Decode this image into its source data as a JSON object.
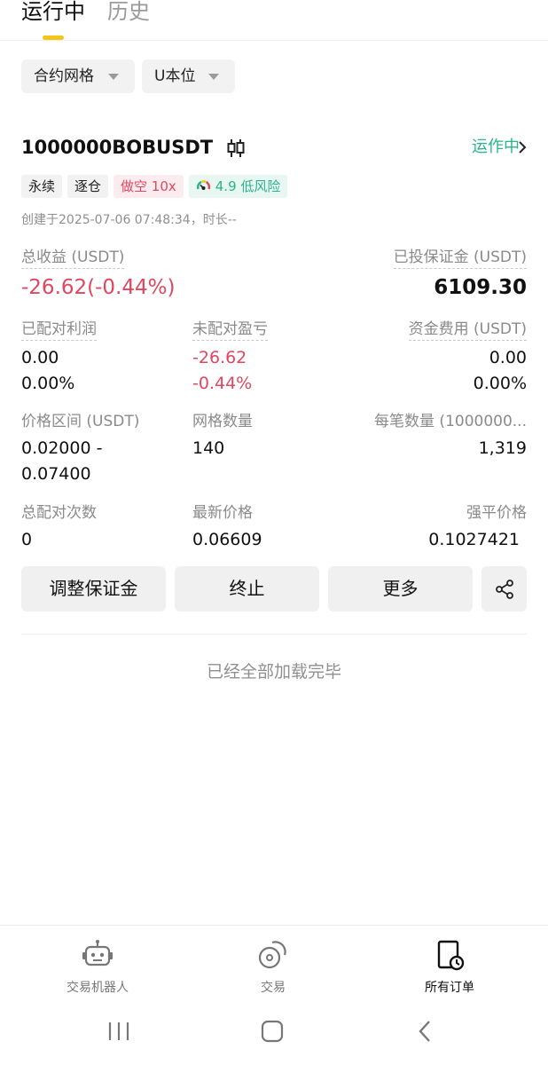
{
  "tabs": {
    "active": "运行中",
    "inactive": "历史"
  },
  "filters": {
    "type": "合约网格",
    "unit": "U本位"
  },
  "card": {
    "symbol": "1000000BOBUSDT",
    "symbol_icon": "candlestick-icon",
    "status": "运作中",
    "tags": {
      "perpetual": "永续",
      "isolated": "逐仓",
      "short": "做空 10x",
      "risk": "4.9 低风险"
    },
    "created": "创建于2025-07-06 07:48:34，时长--",
    "total_profit_label": "总收益 (USDT)",
    "total_profit_value": "-26.62(-0.44%)",
    "margin_label": "已投保证金 (USDT)",
    "margin_value": "6109.30",
    "matched_profit_label": "已配对利润",
    "matched_profit_value": "0.00",
    "matched_profit_pct": "0.00%",
    "unmatched_pnl_label": "未配对盈亏",
    "unmatched_pnl_value": "-26.62",
    "unmatched_pnl_pct": "-0.44%",
    "funding_label": "资金费用 (USDT)",
    "funding_value": "0.00",
    "funding_pct": "0.00%",
    "price_range_label": "价格区间 (USDT)",
    "price_range_low": "0.02000 -",
    "price_range_high": "0.07400",
    "grid_count_label": "网格数量",
    "grid_count_value": "140",
    "per_order_label": "每笔数量 (1000000...",
    "per_order_value": "1,319",
    "match_count_label": "总配对次数",
    "match_count_value": "0",
    "last_price_label": "最新价格",
    "last_price_value": "0.06609",
    "liq_price_label": "强平价格",
    "liq_price_value": "0.1027421"
  },
  "actions": {
    "adjust_margin": "调整保证金",
    "stop": "终止",
    "more": "更多",
    "share_icon": "share-icon"
  },
  "footer_text": "已经全部加载完毕",
  "bottom_nav": [
    {
      "label": "交易机器人",
      "icon": "robot-icon"
    },
    {
      "label": "交易",
      "icon": "coins-icon"
    },
    {
      "label": "所有订单",
      "icon": "orders-clock-icon"
    }
  ],
  "colors": {
    "accent_yellow": "#f5c518",
    "positive_green": "#2bb48a",
    "negative_red": "#e0475f"
  }
}
